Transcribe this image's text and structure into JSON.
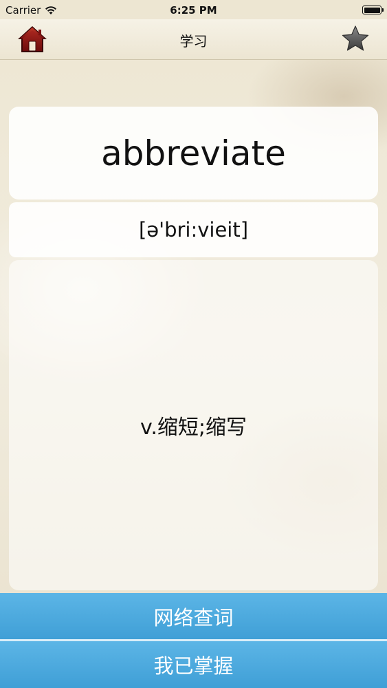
{
  "status_bar": {
    "carrier": "Carrier",
    "time": "6:25 PM",
    "battery_level": 1.0
  },
  "nav": {
    "title": "学习",
    "home_icon": "home-icon",
    "star_icon": "star-icon"
  },
  "word": {
    "text": "abbreviate",
    "phonetic": "[ə'bri:vieit]",
    "meaning": "v.缩短;缩写"
  },
  "buttons": {
    "lookup_label": "网络查词",
    "mastered_label": "我已掌握"
  },
  "colors": {
    "button_blue": "#4aa9de",
    "home_red": "#9b1b1b",
    "star_gray": "#555555"
  }
}
